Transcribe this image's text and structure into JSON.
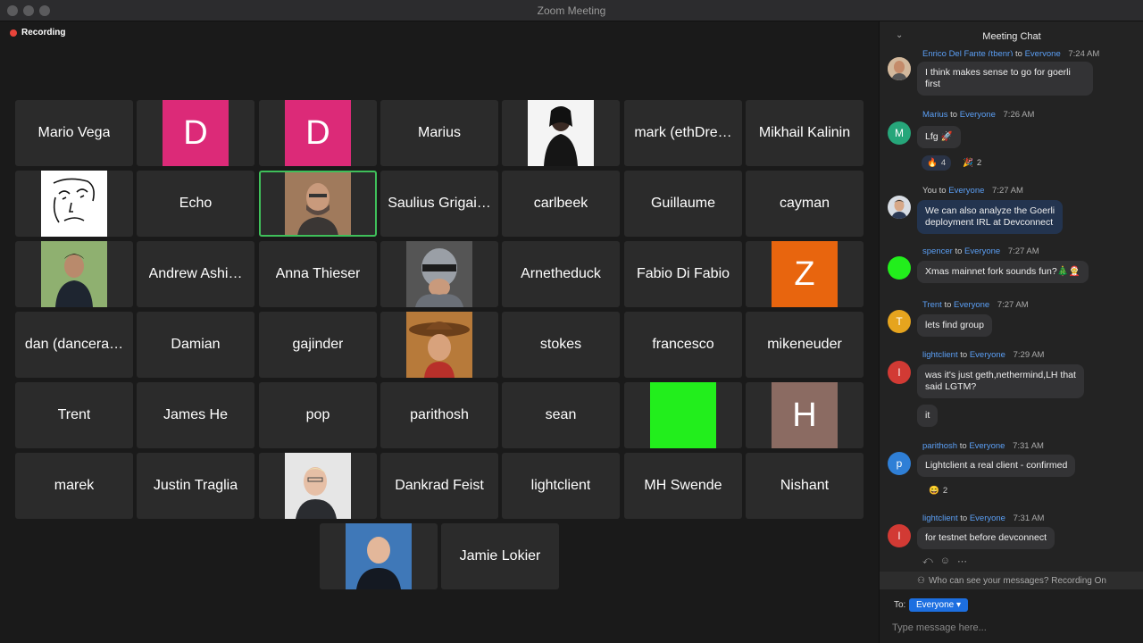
{
  "window": {
    "title": "Zoom Meeting"
  },
  "recording": {
    "label": "Recording"
  },
  "participants": {
    "mario_vega": "Mario Vega",
    "d1_initial": "D",
    "d2_initial": "D",
    "marius": "Marius",
    "mark": "mark (ethDre…",
    "mikhail": "Mikhail Kalinin",
    "echo": "Echo",
    "saulius": "Saulius Grigai…",
    "carlbeek": "carlbeek",
    "guillaume": "Guillaume",
    "cayman": "cayman",
    "andrew": "Andrew Ashi…",
    "anna": "Anna Thieser",
    "arnetheduck": "Arnetheduck",
    "fabio": "Fabio Di Fabio",
    "z_initial": "Z",
    "dan": "dan (dancera…",
    "damian": "Damian",
    "gajinder": "gajinder",
    "stokes": "stokes",
    "francesco": "francesco",
    "mikeneuder": "mikeneuder",
    "trent": "Trent",
    "james": "James He",
    "pop": "pop",
    "parithosh": "parithosh",
    "sean": "sean",
    "h_initial": "H",
    "marek": "marek",
    "justin": "Justin Traglia",
    "dankrad": "Dankrad Feist",
    "lightclient": "lightclient",
    "mhswende": "MH Swende",
    "nishant": "Nishant",
    "jamie": "Jamie Lokier"
  },
  "colors": {
    "pink": "#dc2a78",
    "orange": "#e8650e",
    "brown": "#8b6b62",
    "green": "#22ee1c"
  },
  "chat": {
    "title": "Meeting Chat",
    "messages": [
      {
        "sender": "Enrico Del Fante (tbenr)",
        "to_word": "to",
        "recipient": "Everyone",
        "time": "7:24 AM",
        "text_lines": [
          "I think makes sense to go for goerli",
          "first"
        ]
      },
      {
        "sender": "Marius",
        "to_word": "to",
        "recipient": "Everyone",
        "time": "7:26 AM",
        "text": "Lfg 🚀",
        "reactions": [
          {
            "emoji": "🔥",
            "count": "4"
          },
          {
            "emoji": "🎉",
            "count": "2"
          }
        ],
        "avatar_letter": "M"
      },
      {
        "sender": "You",
        "to_word": "to",
        "recipient": "Everyone",
        "time": "7:27 AM",
        "text_lines": [
          "We can also analyze the Goerli",
          "deployment IRL at Devconnect"
        ]
      },
      {
        "sender": "spencer",
        "to_word": "to",
        "recipient": "Everyone",
        "time": "7:27 AM",
        "text": "Xmas mainnet fork sounds fun?🎄🤶"
      },
      {
        "sender": "Trent",
        "to_word": "to",
        "recipient": "Everyone",
        "time": "7:27 AM",
        "text": "lets find group",
        "avatar_letter": "T"
      },
      {
        "sender": "lightclient",
        "to_word": "to",
        "recipient": "Everyone",
        "time": "7:29 AM",
        "text_lines": [
          "was it's just geth,nethermind,LH that",
          "said LGTM?"
        ],
        "text2": "it",
        "avatar_letter": "l"
      },
      {
        "sender": "parithosh",
        "to_word": "to",
        "recipient": "Everyone",
        "time": "7:31 AM",
        "text": "Lightclient a real client - confirmed",
        "reactions": [
          {
            "emoji": "😄",
            "count": "2"
          }
        ],
        "avatar_letter": "p"
      },
      {
        "sender": "lightclient",
        "to_word": "to",
        "recipient": "Everyone",
        "time": "7:31 AM",
        "text": "for testnet before devconnect",
        "avatar_letter": "l"
      }
    ],
    "privacy_note": "Who can see your messages? Recording On",
    "to_label": "To:",
    "to_value": "Everyone ▾",
    "input_placeholder": "Type message here..."
  }
}
